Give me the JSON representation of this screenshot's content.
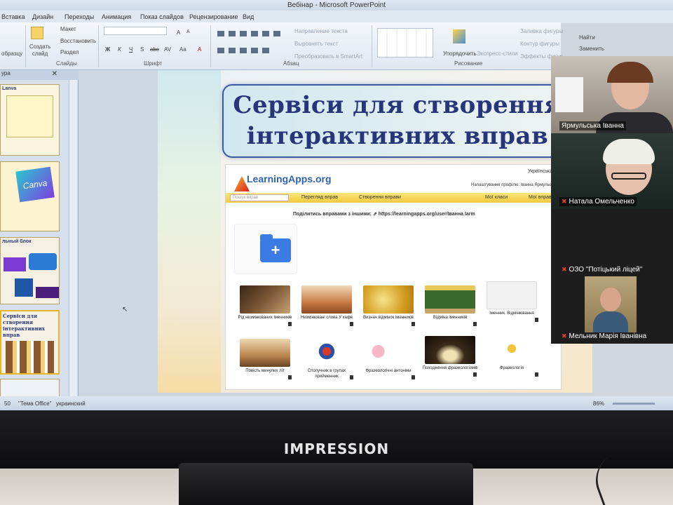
{
  "window": {
    "title": "Вебінар - Microsoft PowerPoint"
  },
  "tabs": [
    "Вставка",
    "Дизайн",
    "Переходы",
    "Анимация",
    "Показ слайдов",
    "Рецензирование",
    "Вид"
  ],
  "ribbon": {
    "clipboard": {
      "paste": "образцу",
      "label": ""
    },
    "slides": {
      "create": "Создать",
      "create2": "слайд",
      "layout": "Макет",
      "restore": "Восстановить",
      "section": "Раздел",
      "label": "Слайды"
    },
    "font": {
      "label": "Шрифт",
      "bold": "Ж",
      "italic": "К",
      "underline": "Ч",
      "shadow": "S",
      "strike": "abc",
      "spacing": "AV",
      "case": "Aa",
      "grow": "A",
      "shrink": "A",
      "color": "A"
    },
    "paragraph": {
      "label": "Абзац",
      "text_direction": "Направление текста",
      "align_text": "Выровнять текст",
      "smartart": "Преобразовать в SmartArt"
    },
    "drawing": {
      "label": "Рисование",
      "arrange": "Упорядочить",
      "quick_styles": "Экспресс-стили",
      "fill": "Заливка фигуры",
      "outline": "Контур фигуры",
      "effects": "Эффекты фигур"
    },
    "editing": {
      "find": "Найти",
      "replace": "Заменить"
    }
  },
  "pane": {
    "header": "ура",
    "thumbs": [
      {
        "title": "Lanva"
      },
      {
        "title": "Canva"
      },
      {
        "title": "льный блок"
      },
      {
        "title": "Сервіси для створення інтерактивних вправ"
      },
      {
        "title": ""
      }
    ]
  },
  "slide": {
    "title_line1": "Сервіси для створення",
    "title_line2": "інтерактивних вправ"
  },
  "learningapps": {
    "logo": "LearningApps.org",
    "language": "Українська",
    "profile": "Налаштування профілю: Іванна Ярмульська",
    "search_placeholder": "Пошук вправ",
    "nav": [
      "Перегляд вправ",
      "Створення вправи",
      "Мої класи",
      "Мої вправи"
    ],
    "share": "Поділитись вправами з іншими: ⇗ https://learningapps.org/user/Іванна Iarm",
    "folder_plus": "+",
    "apps": [
      {
        "label": "Рід незмінюваних іменників",
        "color": "#6b4a2d"
      },
      {
        "label": "Незмінювані слова У кафе",
        "color": "#c58b5a"
      },
      {
        "label": "Визнач відмінок іменників",
        "color": "#d8b53a"
      },
      {
        "label": "Відміна іменників",
        "color": "#3f6a2a"
      },
      {
        "label": "Іменник. Відмінювання",
        "color": "#e8e8e8"
      },
      {
        "label": "Повість минулих літ",
        "color": "#b07a3a"
      },
      {
        "label": "Сполучник в групах прийменник",
        "color": "#ffffff"
      },
      {
        "label": "Фразеологічні антоніми",
        "color": "#ffffff"
      },
      {
        "label": "Походження фразеологізмів",
        "color": "#3a2a1a"
      },
      {
        "label": "Фразеологія",
        "color": "#ffffff"
      }
    ]
  },
  "statusbar": {
    "slide": "50",
    "theme": "\"Тема Office\"",
    "language": "украинский",
    "zoom": "86%"
  },
  "participants": [
    {
      "name": "Ярмульська Іванна",
      "muted": false,
      "bg": "#7d7268"
    },
    {
      "name": "Натала Омельченко",
      "muted": true,
      "bg": "#1f2a2a"
    },
    {
      "name": "ОЗО \"Потіцький ліцей\"",
      "muted": true,
      "bg": "#1c1c1c"
    },
    {
      "name": "Мельник Марія Іванівна",
      "muted": true,
      "bg": "#1c1c1c"
    }
  ],
  "monitor": {
    "brand": "IMPRESSION"
  }
}
